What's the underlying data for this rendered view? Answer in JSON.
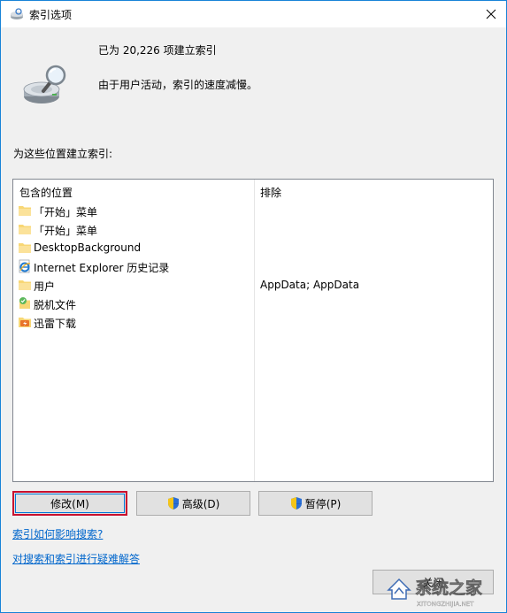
{
  "window": {
    "title": "索引选项",
    "accent": "#1883d7"
  },
  "status": {
    "count_text": "已为 20,226 项建立索引",
    "message": "由于用户活动，索引的速度减慢。"
  },
  "locations": {
    "section_label": "为这些位置建立索引:",
    "headers": {
      "included": "包含的位置",
      "excluded": "排除"
    },
    "rows": [
      {
        "icon": "folder-icon",
        "name": "「开始」菜单",
        "excluded": ""
      },
      {
        "icon": "folder-icon",
        "name": "「开始」菜单",
        "excluded": ""
      },
      {
        "icon": "folder-icon",
        "name": "DesktopBackground",
        "excluded": ""
      },
      {
        "icon": "internet-explorer-icon",
        "name": "Internet Explorer 历史记录",
        "excluded": ""
      },
      {
        "icon": "folder-icon",
        "name": "用户",
        "excluded": "AppData; AppData"
      },
      {
        "icon": "offline-files-icon",
        "name": "脱机文件",
        "excluded": ""
      },
      {
        "icon": "thunder-download-icon",
        "name": "迅雷下载",
        "excluded": ""
      }
    ]
  },
  "buttons": {
    "modify": "修改(M)",
    "advanced": "高级(D)",
    "pause": "暂停(P)",
    "close": "关闭"
  },
  "links": {
    "how_indexing": "索引如何影响搜索?",
    "troubleshoot": "对搜索和索引进行疑难解答"
  },
  "watermark": {
    "cn": "系统之家",
    "en": "XITONGZHIJIA.NET"
  }
}
